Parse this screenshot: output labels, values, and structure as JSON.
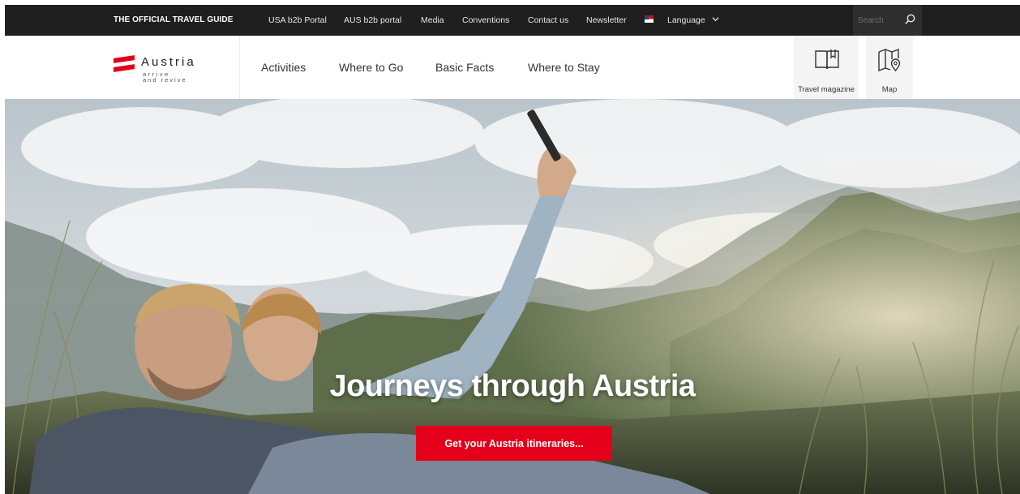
{
  "topbar": {
    "guide_label": "THE OFFICIAL TRAVEL GUIDE",
    "links": [
      "USA b2b Portal",
      "AUS b2b portal",
      "Media",
      "Conventions",
      "Contact us",
      "Newsletter"
    ],
    "language_label": "Language",
    "search_placeholder": "Search",
    "flag_icon": "us-flag-icon",
    "search_icon": "search-icon"
  },
  "brand": {
    "name": "Austria",
    "tagline_line1": "arrive",
    "tagline_line2": "and revive",
    "accent_color": "#e2001a"
  },
  "nav": {
    "items": [
      "Activities",
      "Where to Go",
      "Basic Facts",
      "Where to Stay"
    ]
  },
  "tools": {
    "magazine_label": "Travel magazine",
    "magazine_icon": "book-icon",
    "map_label": "Map",
    "map_icon": "map-pin-icon"
  },
  "hero": {
    "title": "Journeys through Austria",
    "cta_label": "Get your Austria itineraries...",
    "cta_color": "#e4001b"
  }
}
